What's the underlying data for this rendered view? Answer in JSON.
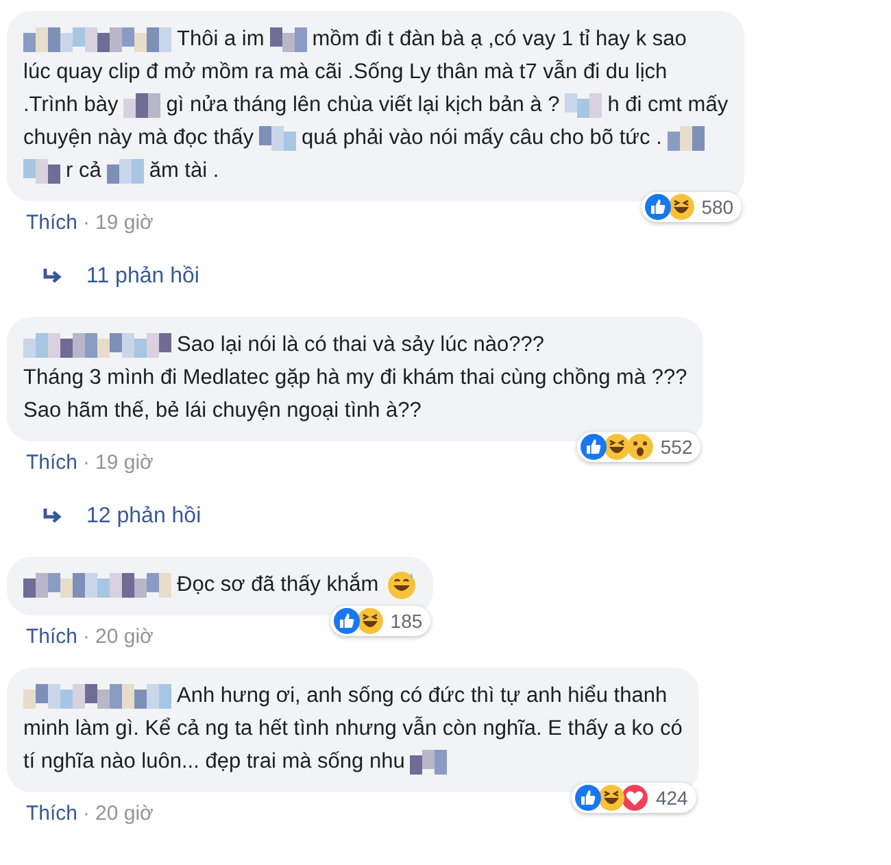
{
  "comments": [
    {
      "lines": [
        [
          {
            "kind": "name_blur"
          },
          {
            "kind": "text",
            "text": "Thôi a im"
          },
          {
            "kind": "blur"
          },
          {
            "kind": "text",
            "text": "mồm đi t đàn bà ạ ,có vay 1 tỉ hay k sao"
          }
        ],
        [
          {
            "kind": "text",
            "text": "lúc quay clip đ mở mồm ra mà cãi .Sống Ly thân mà t7 vẫn đi du lịch"
          }
        ],
        [
          {
            "kind": "text",
            "text": ".Trình bày"
          },
          {
            "kind": "blur"
          },
          {
            "kind": "text",
            "text": "gì nửa tháng lên chùa viết lại kịch bản à ?"
          },
          {
            "kind": "blur"
          },
          {
            "kind": "text",
            "text": "h đi cmt mấy"
          }
        ],
        [
          {
            "kind": "text",
            "text": "chuyện này mà đọc thấy"
          },
          {
            "kind": "blur"
          },
          {
            "kind": "text",
            "text": "quá phải vào nói mấy câu cho bõ tức ."
          },
          {
            "kind": "blur"
          }
        ],
        [
          {
            "kind": "blur"
          },
          {
            "kind": "text",
            "text": "r cả"
          },
          {
            "kind": "blur"
          },
          {
            "kind": "text",
            "text": "ăm tài ."
          }
        ]
      ],
      "reactions": [
        {
          "kind": "like"
        },
        {
          "kind": "haha"
        }
      ],
      "reaction_count": "580",
      "like_label": "Thích",
      "separator": "·",
      "time": "19 giờ",
      "replies": "11 phản hồi"
    },
    {
      "lines": [
        [
          {
            "kind": "name_blur"
          },
          {
            "kind": "text",
            "text": "Sao lại nói là có thai và sảy lúc nào???"
          }
        ],
        [
          {
            "kind": "text",
            "text": "Tháng 3 mình đi Medlatec gặp hà my đi khám thai cùng chồng mà ???"
          }
        ],
        [
          {
            "kind": "text",
            "text": "Sao hãm thế, bẻ lái chuyện ngoại tình à??"
          }
        ]
      ],
      "reactions": [
        {
          "kind": "like"
        },
        {
          "kind": "haha"
        },
        {
          "kind": "wow"
        }
      ],
      "reaction_count": "552",
      "like_label": "Thích",
      "separator": "·",
      "time": "19 giờ",
      "replies": "12 phản hồi"
    },
    {
      "lines": [
        [
          {
            "kind": "name_blur"
          },
          {
            "kind": "text",
            "text": "Đọc sơ đã thấy khắm"
          },
          {
            "kind": "emoji"
          }
        ]
      ],
      "reactions": [
        {
          "kind": "like"
        },
        {
          "kind": "haha"
        }
      ],
      "reaction_count": "185",
      "like_label": "Thích",
      "separator": "·",
      "time": "20 giờ"
    },
    {
      "lines": [
        [
          {
            "kind": "name_blur"
          },
          {
            "kind": "text",
            "text": "Anh hưng ơi, anh sống có đức thì tự anh hiểu thanh"
          }
        ],
        [
          {
            "kind": "text",
            "text": "minh làm gì. Kể cả ng ta hết tình nhưng vẫn còn nghĩa. E thấy a ko có"
          }
        ],
        [
          {
            "kind": "text",
            "text": "tí nghĩa nào luôn... đẹp trai mà sống nhu"
          },
          {
            "kind": "blur"
          }
        ]
      ],
      "reactions": [
        {
          "kind": "like"
        },
        {
          "kind": "haha"
        },
        {
          "kind": "love"
        }
      ],
      "reaction_count": "424",
      "like_label": "Thích",
      "separator": "·",
      "time": "20 giờ"
    }
  ]
}
